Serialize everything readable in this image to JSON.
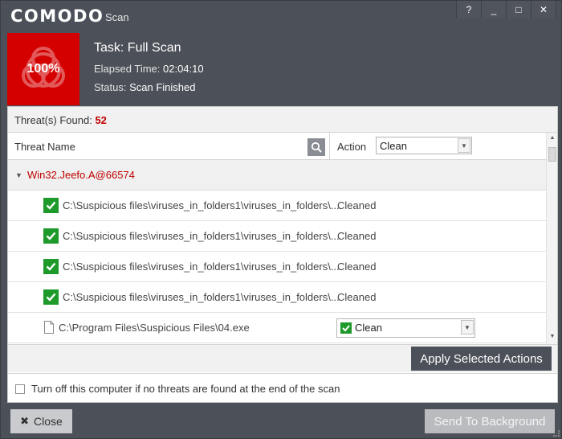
{
  "app": {
    "brand": "COMODO",
    "window_title": "Scan"
  },
  "window_controls": {
    "help": "?",
    "minimize": "_",
    "maximize": "□",
    "close": "✕"
  },
  "status": {
    "progress": "100%",
    "task_label": "Task:",
    "task_value": "Full Scan",
    "elapsed_label": "Elapsed Time:",
    "elapsed_value": "02:04:10",
    "status_label": "Status:",
    "status_value": "Scan Finished",
    "colors": {
      "progress_bg": "#d40000",
      "header_bg": "#4c5058"
    }
  },
  "threats": {
    "found_label": "Threat(s) Found:",
    "found_count": "52",
    "columns": {
      "name": "Threat Name",
      "action": "Action"
    },
    "action_selected": "Clean",
    "group": {
      "name": "Win32.Jeefo.A@66574",
      "expanded": true
    },
    "rows": [
      {
        "path": "C:\\Suspicious files\\viruses_in_folders1\\viruses_in_folders\\...",
        "result": "Cleaned",
        "icon": "check-icon"
      },
      {
        "path": "C:\\Suspicious files\\viruses_in_folders1\\viruses_in_folders\\...",
        "result": "Cleaned",
        "icon": "check-icon"
      },
      {
        "path": "C:\\Suspicious files\\viruses_in_folders1\\viruses_in_folders\\...",
        "result": "Cleaned",
        "icon": "check-icon"
      },
      {
        "path": "C:\\Suspicious files\\viruses_in_folders1\\viruses_in_folders\\...",
        "result": "Cleaned",
        "icon": "check-icon"
      }
    ],
    "pending_row": {
      "path": "C:\\Program Files\\Suspicious Files\\04.exe",
      "action_selected": "Clean",
      "icon": "file-icon"
    }
  },
  "actions": {
    "apply": "Apply Selected Actions"
  },
  "options": {
    "shutdown_label": "Turn off this computer if no threats are found at the end of the scan",
    "shutdown_checked": false
  },
  "footer": {
    "close": "Close",
    "background": "Send To Background"
  }
}
